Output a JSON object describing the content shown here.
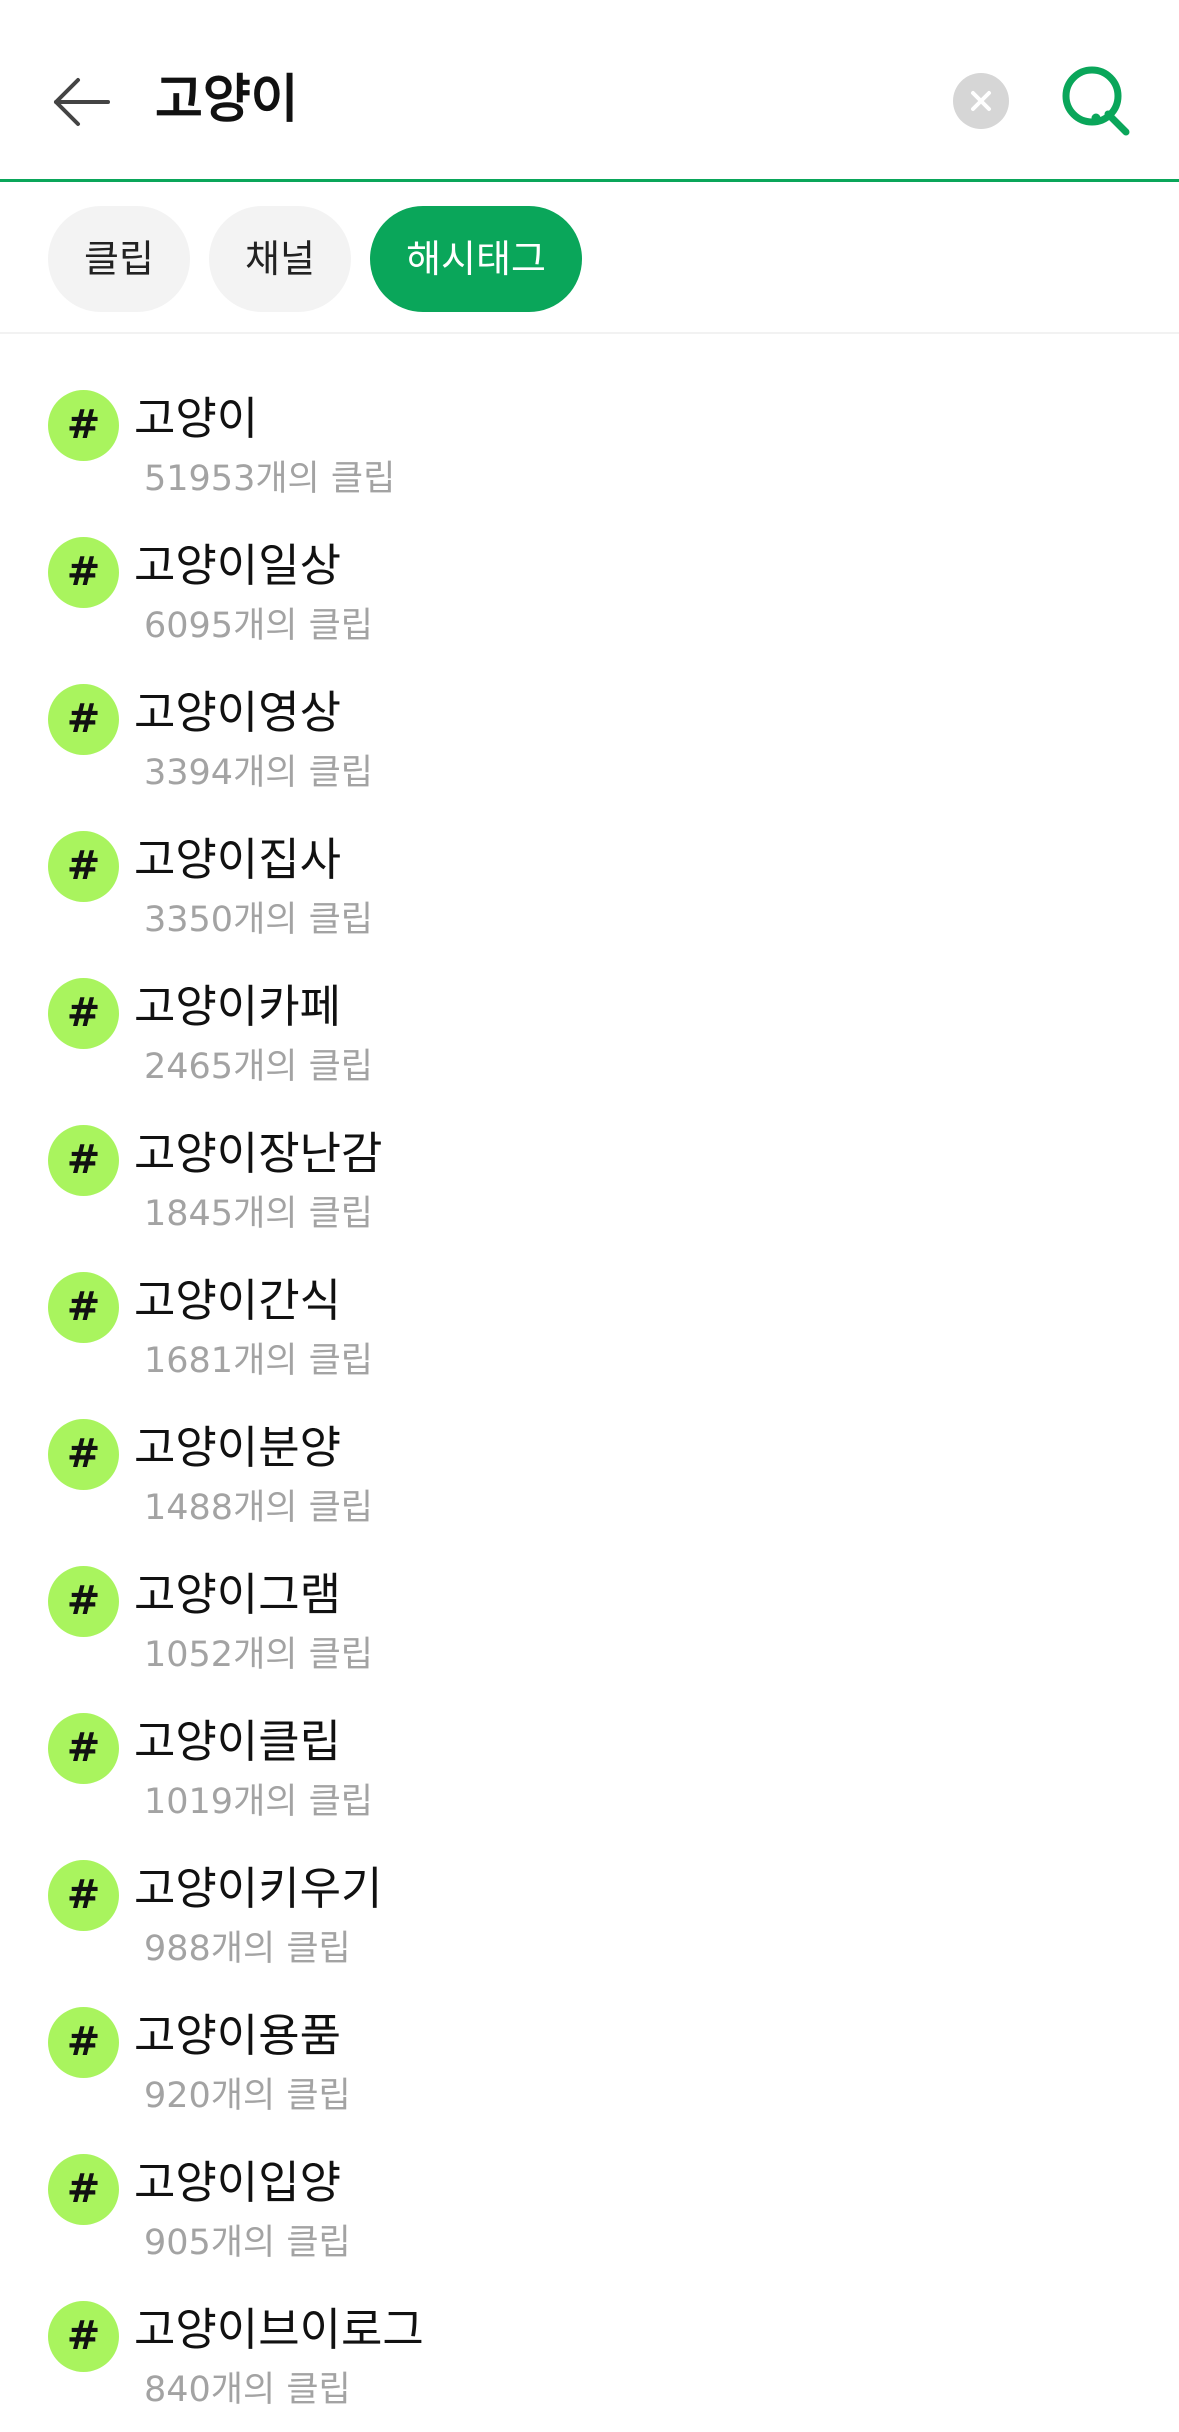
{
  "search": {
    "query": "고양이"
  },
  "tabs": [
    {
      "label": "클립",
      "active": false
    },
    {
      "label": "채널",
      "active": false
    },
    {
      "label": "해시태그",
      "active": true
    }
  ],
  "colors": {
    "accent": "#0aa65a",
    "hash_badge": "#a9f45e",
    "count_text": "#a3a3a3"
  },
  "icons": {
    "back": "arrow-left-icon",
    "clear": "close-circle-icon",
    "search": "search-icon",
    "hashtag": "hash-icon"
  },
  "hash_symbol": "#",
  "hashtags": [
    {
      "tag": "고양이",
      "count": "51953개의 클립"
    },
    {
      "tag": "고양이일상",
      "count": "6095개의 클립"
    },
    {
      "tag": "고양이영상",
      "count": "3394개의 클립"
    },
    {
      "tag": "고양이집사",
      "count": "3350개의 클립"
    },
    {
      "tag": "고양이카페",
      "count": "2465개의 클립"
    },
    {
      "tag": "고양이장난감",
      "count": "1845개의 클립"
    },
    {
      "tag": "고양이간식",
      "count": "1681개의 클립"
    },
    {
      "tag": "고양이분양",
      "count": "1488개의 클립"
    },
    {
      "tag": "고양이그램",
      "count": "1052개의 클립"
    },
    {
      "tag": "고양이클립",
      "count": "1019개의 클립"
    },
    {
      "tag": "고양이키우기",
      "count": "988개의 클립"
    },
    {
      "tag": "고양이용품",
      "count": "920개의 클립"
    },
    {
      "tag": "고양이입양",
      "count": "905개의 클립"
    },
    {
      "tag": "고양이브이로그",
      "count": "840개의 클립"
    }
  ]
}
